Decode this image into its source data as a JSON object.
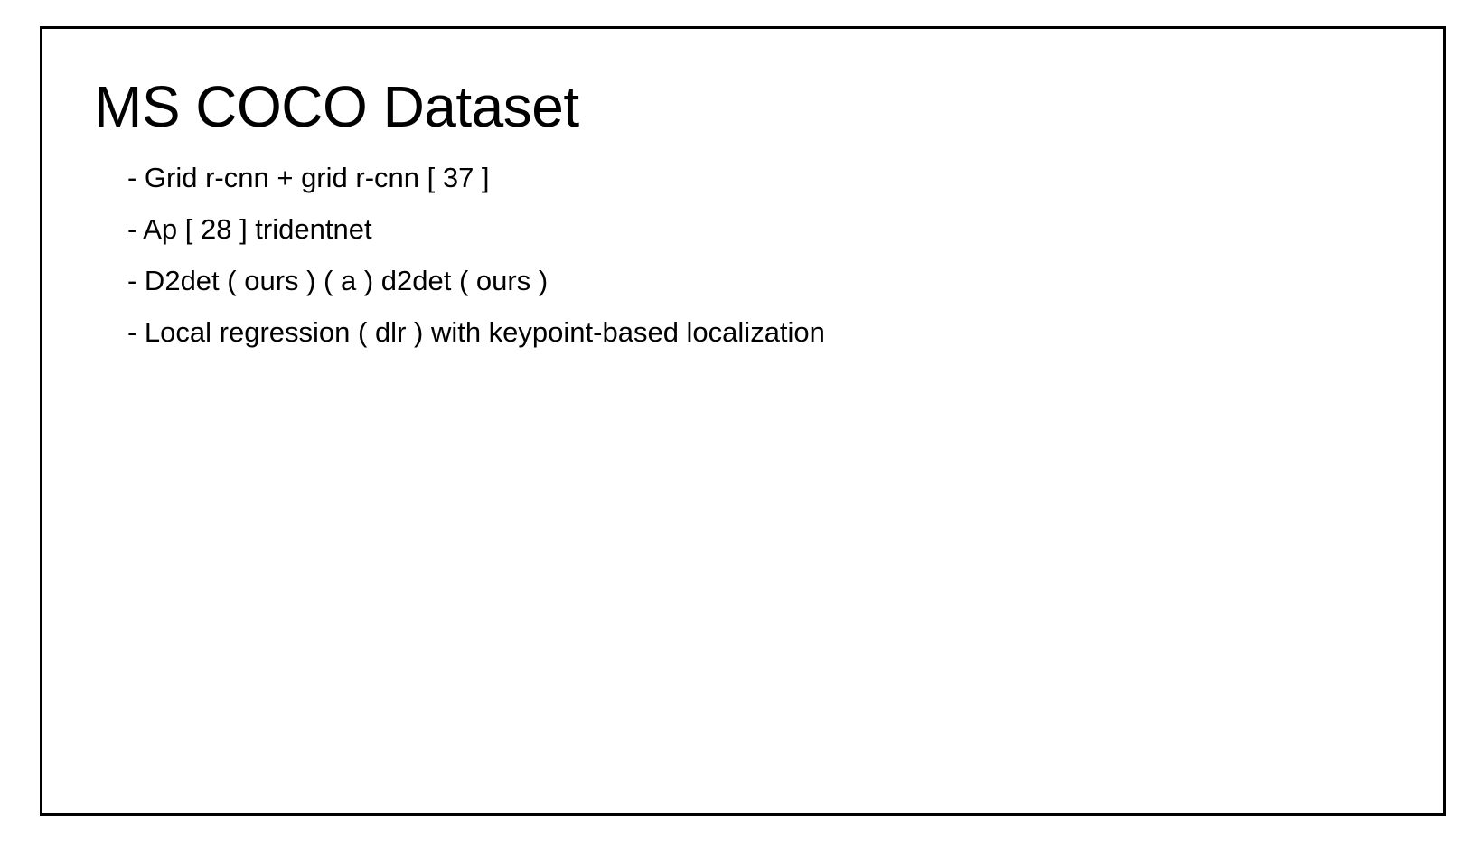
{
  "slide": {
    "title": "MS COCO Dataset",
    "bullets": [
      "- Grid r-cnn + grid r-cnn [ 37 ]",
      "- Ap [ 28 ] tridentnet",
      "- D2det ( ours ) ( a ) d2det ( ours )",
      "- Local regression ( dlr ) with keypoint-based localization"
    ]
  }
}
